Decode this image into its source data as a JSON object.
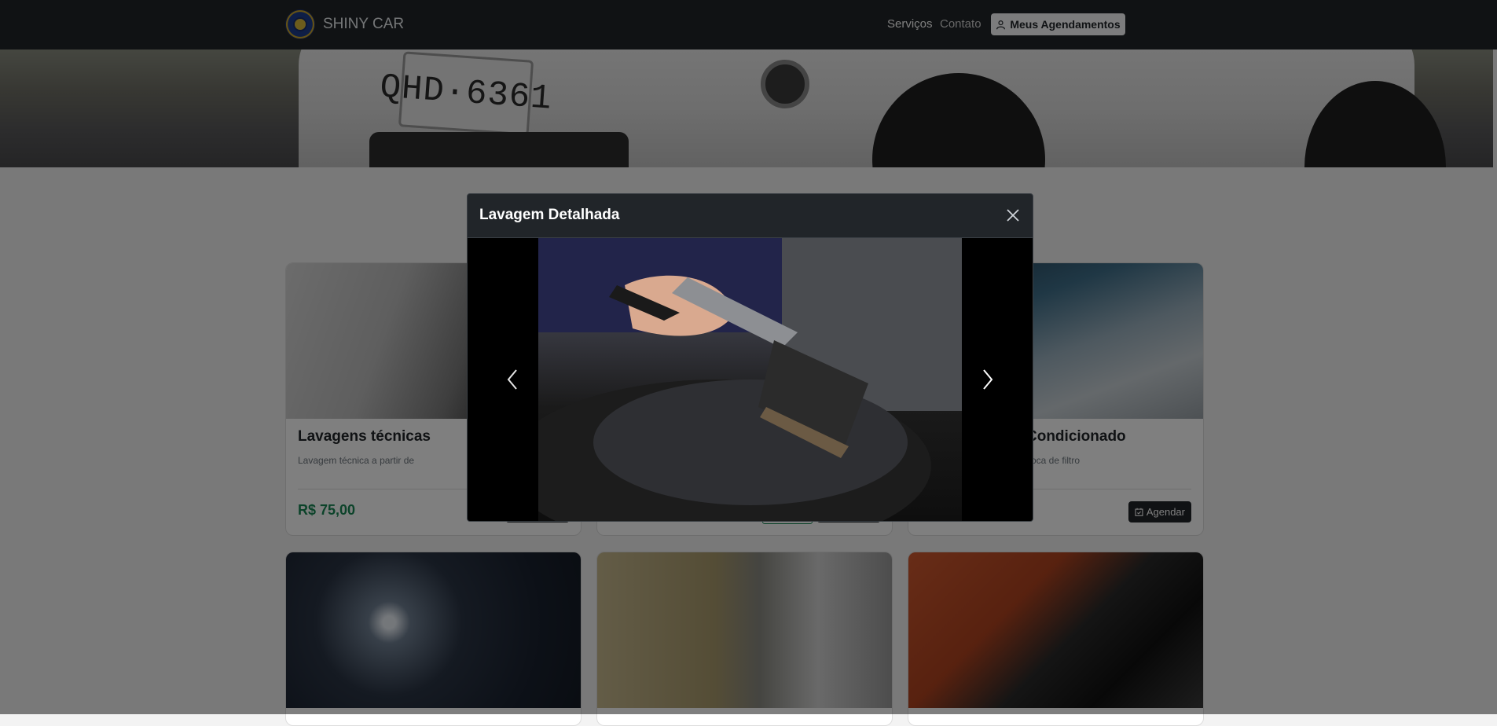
{
  "navbar": {
    "brand": "SHINY CAR",
    "links": [
      "Serviços",
      "Contato"
    ],
    "appointments_button": "Meus Agendamentos"
  },
  "hero": {
    "plate_text": "QHD·6361"
  },
  "cards": [
    {
      "title": "Lavagens técnicas",
      "description": "Lavagem técnica a partir de",
      "price": "R$ 75,00"
    },
    {
      "title": "Condicionado",
      "description": "roca de filtro",
      "button": "Agendar"
    }
  ],
  "modal": {
    "title": "Lavagem Detalhada"
  },
  "icons": {
    "user": "user-icon",
    "calendar": "calendar-check-icon",
    "close": "close-icon",
    "prev": "chevron-left-icon",
    "next": "chevron-right-icon"
  }
}
